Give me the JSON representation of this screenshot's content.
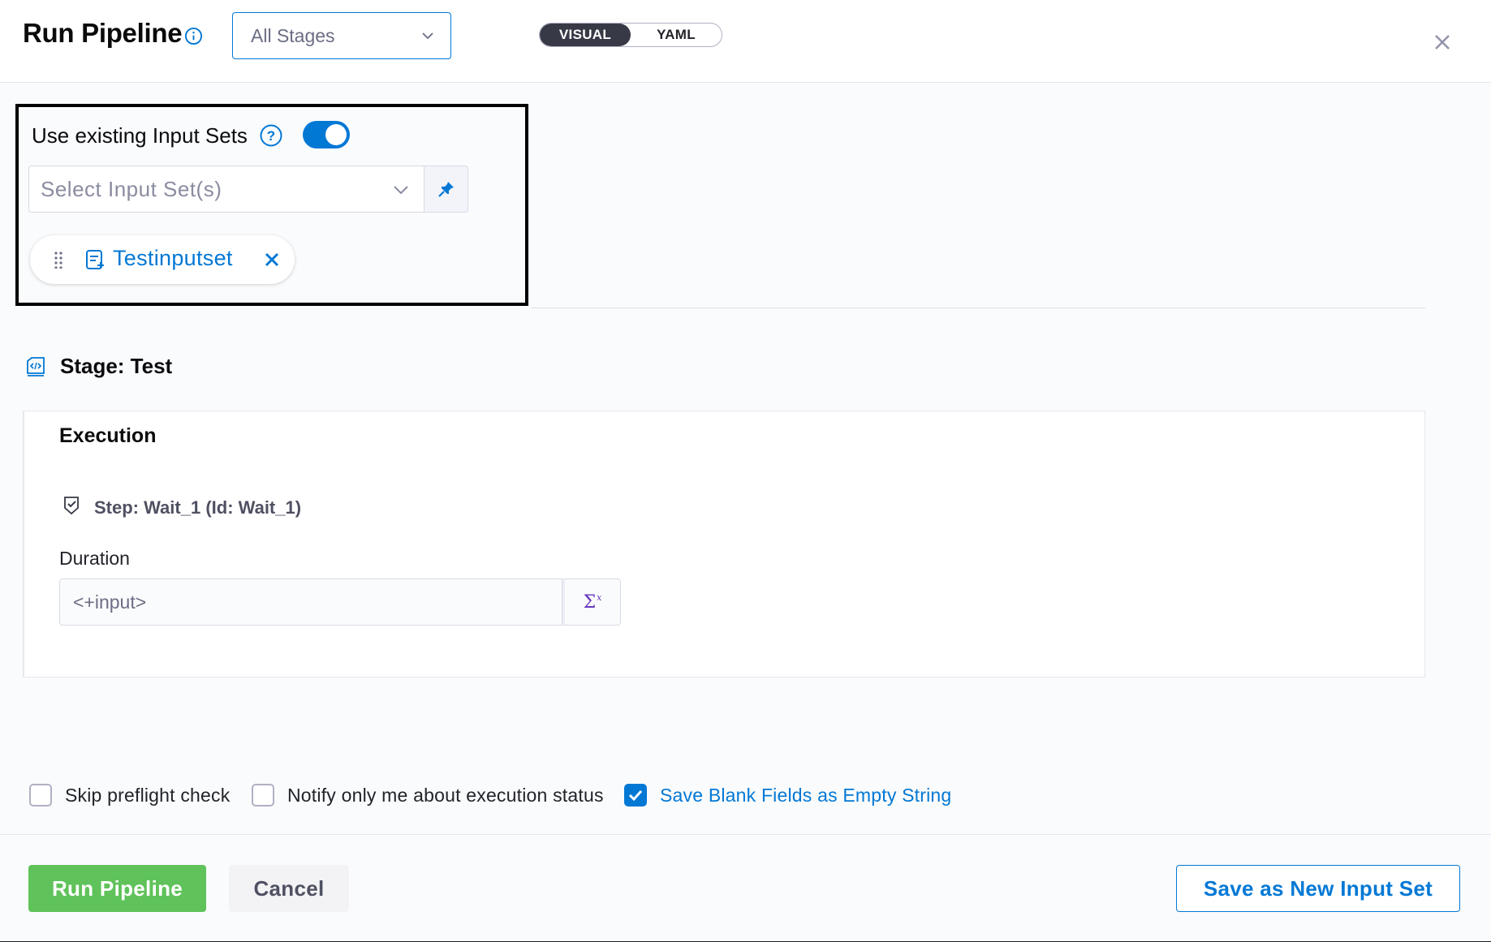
{
  "header": {
    "title": "Run Pipeline",
    "stage_select": {
      "value": "All Stages"
    },
    "view_toggle": {
      "options": [
        "VISUAL",
        "YAML"
      ],
      "selected": "VISUAL"
    }
  },
  "input_sets": {
    "label": "Use existing Input Sets",
    "toggle_on": true,
    "select_placeholder": "Select Input Set(s)",
    "selected": [
      {
        "name": "Testinputset"
      }
    ]
  },
  "stage": {
    "title": "Stage: Test",
    "section_title": "Execution",
    "step_label": "Step: Wait_1 (Id: Wait_1)",
    "duration_label": "Duration",
    "duration_value": "<+input>"
  },
  "options": {
    "skip_preflight": {
      "label": "Skip preflight check",
      "checked": false
    },
    "notify_only_me": {
      "label": "Notify only me about execution status",
      "checked": false
    },
    "save_blank": {
      "label": "Save Blank Fields as Empty String",
      "checked": true
    }
  },
  "footer": {
    "run_label": "Run Pipeline",
    "cancel_label": "Cancel",
    "save_new_label": "Save as New Input Set"
  },
  "colors": {
    "accent": "#0278d5",
    "run_button": "#5fc25a",
    "expression": "#6938c0"
  }
}
